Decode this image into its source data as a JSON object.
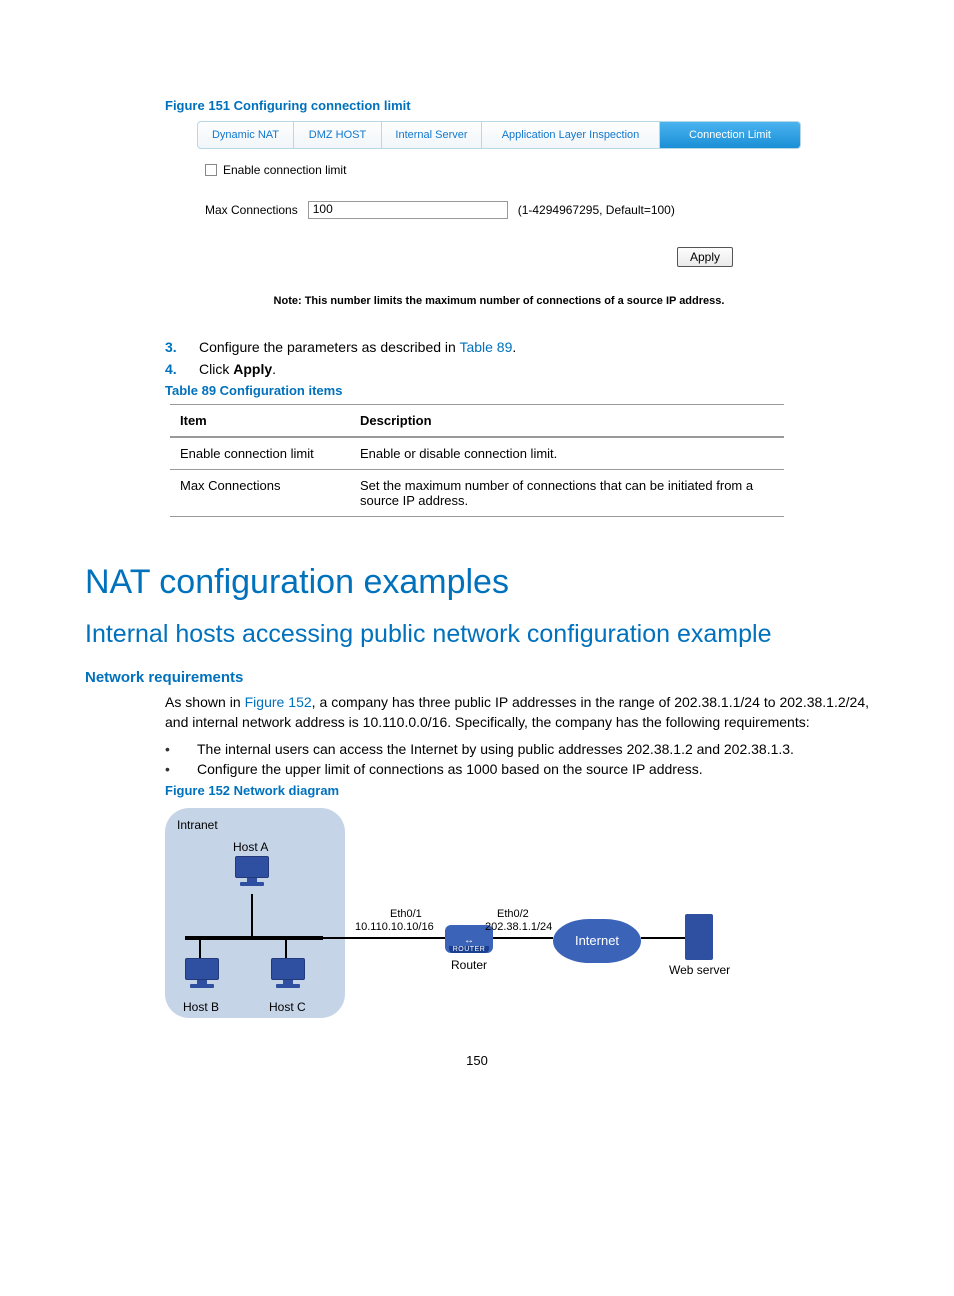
{
  "fig151": {
    "caption": "Figure 151 Configuring connection limit",
    "tabs": [
      "Dynamic NAT",
      "DMZ HOST",
      "Internal Server",
      "Application Layer Inspection",
      "Connection Limit"
    ],
    "active_tab_index": 4,
    "checkbox_label": "Enable connection limit",
    "max_conn_label": "Max Connections",
    "max_conn_value": "100",
    "max_conn_hint": "(1-4294967295, Default=100)",
    "apply_label": "Apply",
    "note": "Note: This number limits the maximum number of connections of a source IP address."
  },
  "steps": [
    {
      "n": "3.",
      "pre": "Configure the parameters as described in ",
      "link": "Table 89",
      "post": "."
    },
    {
      "n": "4.",
      "pre": "Click ",
      "bold": "Apply",
      "post": "."
    }
  ],
  "table89": {
    "caption": "Table 89 Configuration items",
    "headers": [
      "Item",
      "Description"
    ],
    "rows": [
      [
        "Enable connection limit",
        "Enable or disable connection limit."
      ],
      [
        "Max Connections",
        "Set the maximum number of connections that can be initiated from a source IP address."
      ]
    ]
  },
  "h1": "NAT configuration examples",
  "h2": "Internal hosts accessing public network configuration example",
  "sec_head": "Network requirements",
  "para": {
    "pre": "As shown in ",
    "link": "Figure 152",
    "post": ", a company has three public IP addresses in the range of 202.38.1.1/24 to 202.38.1.2/24, and internal network address is 10.110.0.0/16. Specifically, the company has the following requirements:"
  },
  "bullets": [
    "The internal users can access the Internet by using public addresses 202.38.1.2 and 202.38.1.3.",
    "Configure the upper limit of connections as 1000 based on the source IP address."
  ],
  "fig152": {
    "caption": "Figure 152 Network diagram",
    "labels": {
      "intranet": "Intranet",
      "host_a": "Host A",
      "host_b": "Host B",
      "host_c": "Host C",
      "eth01": "Eth0/1",
      "ip01": "10.110.10.10/16",
      "eth02": "Eth0/2",
      "ip02": "202.38.1.1/24",
      "router": "Router",
      "router_tag": "ROUTER",
      "internet": "Internet",
      "webserver": "Web server"
    }
  },
  "page_number": "150"
}
